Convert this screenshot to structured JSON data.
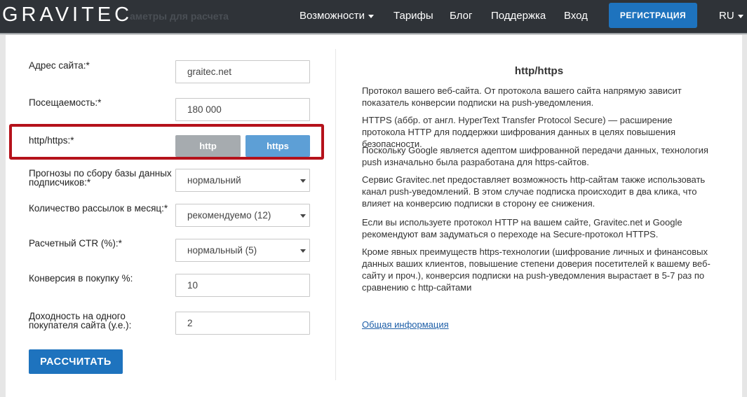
{
  "header": {
    "logo": "GRAVITEC",
    "ghost_title": "аметры для расчета",
    "nav": [
      "Возможности",
      "Тарифы",
      "Блог",
      "Поддержка",
      "Вход"
    ],
    "register_label": "РЕГИСТРАЦИЯ",
    "language": "RU"
  },
  "form": {
    "site_label": "Адрес сайта:*",
    "site_value": "graitec.net",
    "traffic_label": "Посещаемость:*",
    "traffic_value": "180 000",
    "protocol_label": "http/https:*",
    "protocol_options": [
      "http",
      "https"
    ],
    "protocol_selected": "https",
    "forecast_label_1": "Прогнозы по сбору базы данных",
    "forecast_label_2": "подписчиков:*",
    "forecast_value": "нормальний",
    "mailings_label": "Количество рассылок в месяц:*",
    "mailings_value": "рекомендуемо (12)",
    "ctr_label": "Расчетный CTR (%):*",
    "ctr_value": "нормальный (5)",
    "conversion_label": "Конверсия в покупку %:",
    "conversion_value": "10",
    "income_label_1": "Доходность на одного",
    "income_label_2": "покупателя сайта (у.е.):",
    "income_value": "2",
    "calculate_label": "РАССЧИТАТЬ"
  },
  "info": {
    "title": "http/https",
    "p1": "Протокол вашего веб-сайта. От протокола вашего сайта напрямую зависит показатель конверсии подписки на push-уведомления.",
    "p2": "HTTPS (аббр. от англ. HyperText Transfer Protocol Secure) — расширение протокола HTTP для поддержки шифрования данных в целях повышения безопасности.",
    "p3": "Поскольку Google является адептом шифрованной передачи данных, технология push изначально была разработана для https-сайтов.",
    "p4": "Сервис Gravitec.net предоставляет возможность http-сайтам также использовать канал push-уведомлений. В этом случае подписка происходит в два клика, что влияет на конверсию подписки в сторону ее снижения.",
    "p5": "Если вы используете протокол HTTP на вашем сайте, Gravitec.net и Google рекомендуют вам задуматься о переходе на Secure-протокол HTTPS.",
    "p6": "Кроме явных преимуществ https-технологии (шифрование личных и финансовых данных ваших клиентов, повышение степени доверия посетителей к вашему веб-сайту и проч.), конверсия подписки на push-уведомления вырастает в 5-7 раз по сравнению с http-сайтами",
    "link": "Общая информация"
  },
  "colors": {
    "header_bg": "#2f3338",
    "accent": "#1e73be",
    "highlight_border": "#b5121b",
    "toggle_inactive": "#a6abaf",
    "toggle_active": "#5d9fd6"
  }
}
